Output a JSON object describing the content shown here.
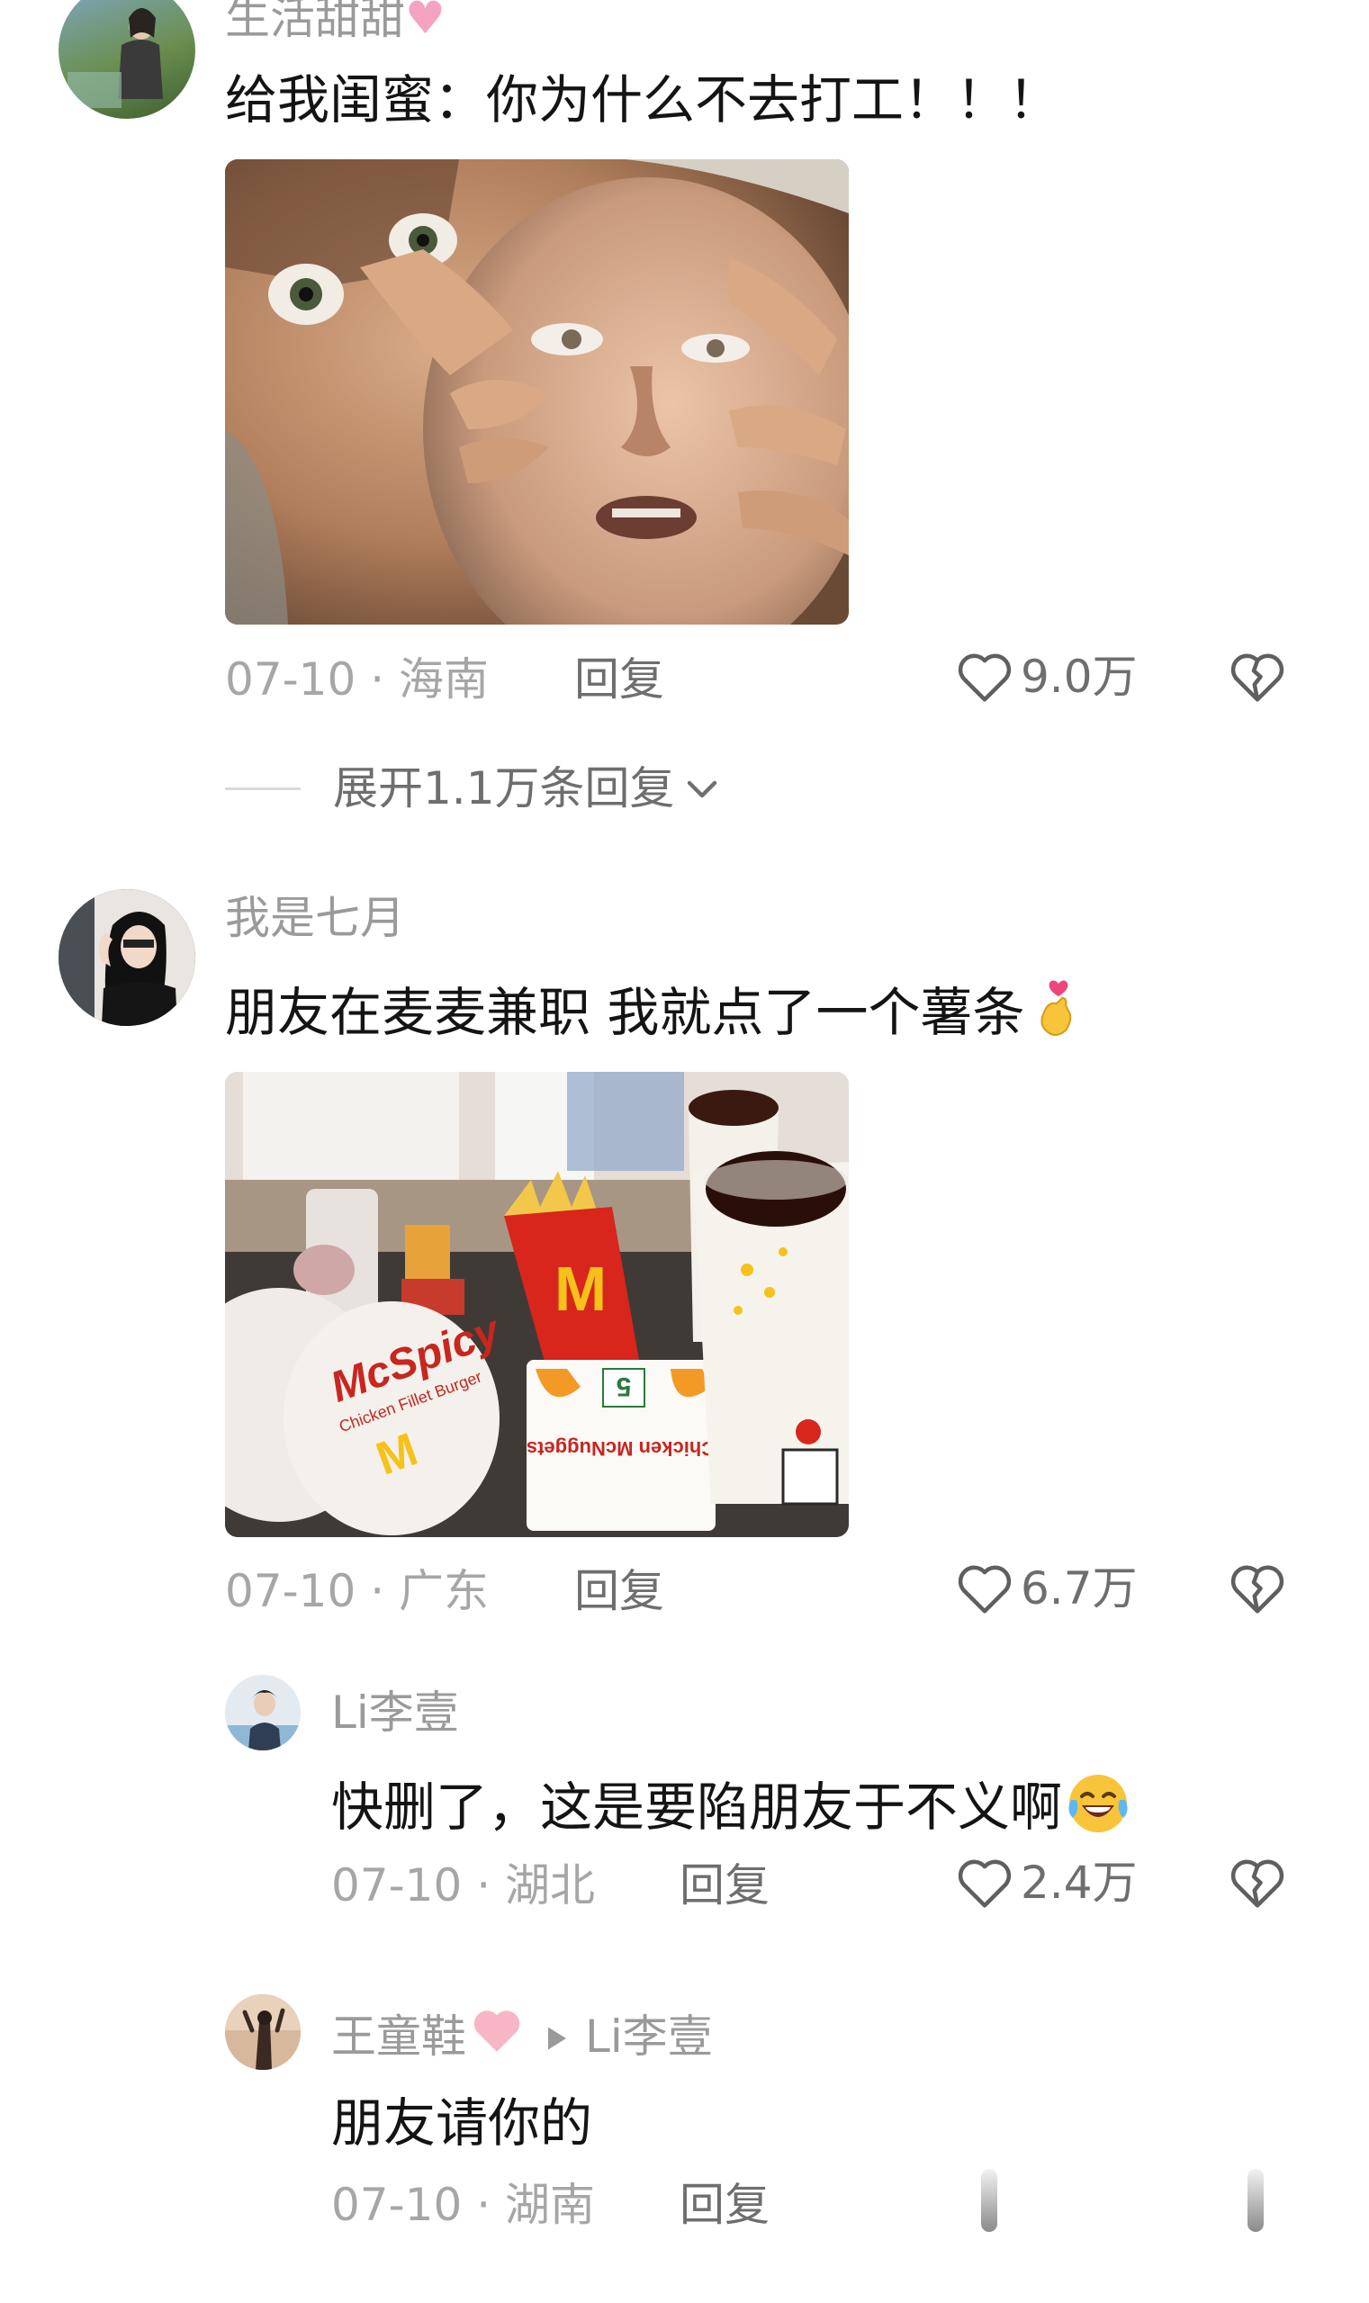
{
  "comments": [
    {
      "username": "生活甜甜",
      "text": "给我闺蜜：你为什么不去打工！！！",
      "date": "07-10",
      "location": "海南",
      "reply_label": "回复",
      "likes": "9.0万",
      "expand_label": "展开1.1万条回复"
    },
    {
      "username": "我是七月",
      "text": "朋友在麦麦兼职  我就点了一个薯条",
      "date": "07-10",
      "location": "广东",
      "reply_label": "回复",
      "likes": "6.7万",
      "image": {
        "logo": "M",
        "fries_number": "5",
        "burger_brand": "McSpicy",
        "burger_sub": "Chicken Fillet Burger",
        "nuggets_label": "Chicken McNuggets"
      },
      "replies": [
        {
          "username": "Li李壹",
          "text": "快删了，这是要陷朋友于不义啊",
          "date": "07-10",
          "location": "湖北",
          "reply_label": "回复",
          "likes": "2.4万"
        },
        {
          "username": "王童鞋",
          "reply_to": "Li李壹",
          "text": "朋友请你的",
          "date": "07-10",
          "location": "湖南",
          "reply_label": "回复"
        }
      ]
    }
  ],
  "separator": "·",
  "colors": {
    "meta_gray": "#a6a6a6",
    "text": "#141414",
    "heart_pink": "#f5b5c6",
    "mcd_red": "#d8261c",
    "mcd_yellow": "#f6c21a"
  }
}
